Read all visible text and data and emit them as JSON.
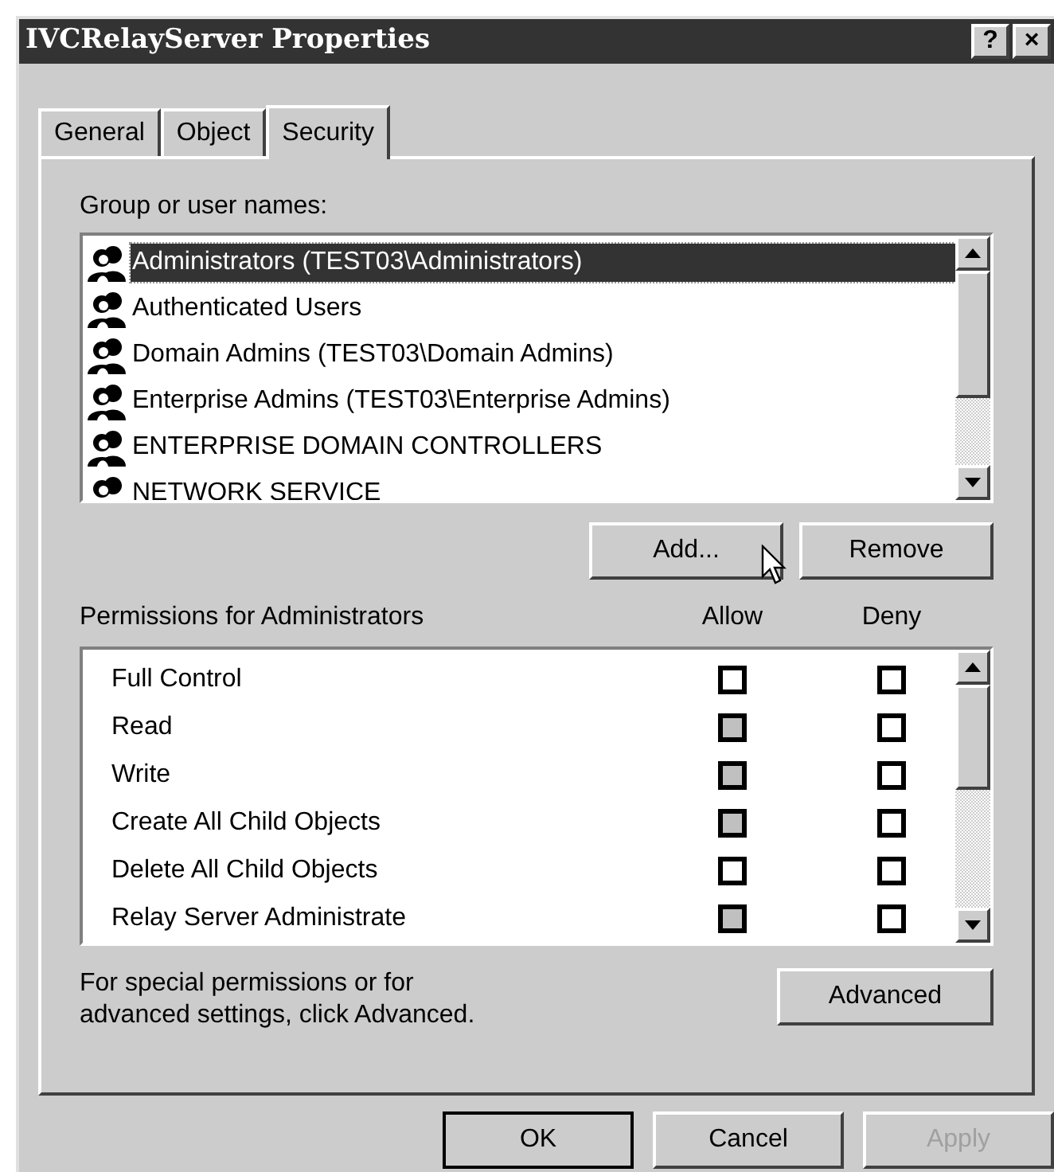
{
  "window": {
    "title": "IVCRelayServer Properties",
    "title_buttons": [
      "?",
      "×"
    ]
  },
  "tabs": [
    {
      "label": "General",
      "selected": false
    },
    {
      "label": "Object",
      "selected": false
    },
    {
      "label": "Security",
      "selected": true
    }
  ],
  "group_list": {
    "label": "Group or user names:",
    "items": [
      {
        "name": "Administrators (TEST03\\Administrators)",
        "selected": true
      },
      {
        "name": "Authenticated Users",
        "selected": false
      },
      {
        "name": "Domain Admins (TEST03\\Domain Admins)",
        "selected": false
      },
      {
        "name": "Enterprise Admins (TEST03\\Enterprise Admins)",
        "selected": false
      },
      {
        "name": "ENTERPRISE DOMAIN CONTROLLERS",
        "selected": false
      },
      {
        "name": "NETWORK SERVICE",
        "selected": false
      }
    ]
  },
  "group_buttons": [
    {
      "label": "Add..."
    },
    {
      "label": "Remove"
    }
  ],
  "permissions": {
    "label": "Permissions for Administrators",
    "allow_header": "Allow",
    "deny_header": "Deny",
    "rows": [
      {
        "name": "Full Control",
        "allow_greyed": false,
        "deny_greyed": false
      },
      {
        "name": "Read",
        "allow_greyed": true,
        "deny_greyed": false
      },
      {
        "name": "Write",
        "allow_greyed": true,
        "deny_greyed": false
      },
      {
        "name": "Create All Child Objects",
        "allow_greyed": true,
        "deny_greyed": false
      },
      {
        "name": "Delete All Child Objects",
        "allow_greyed": false,
        "deny_greyed": false
      },
      {
        "name": "Relay Server Administrate",
        "allow_greyed": true,
        "deny_greyed": false
      }
    ]
  },
  "advanced": {
    "note": "For special permissions or for advanced settings, click Advanced.",
    "button": {
      "label": "Advanced"
    }
  },
  "footer_buttons": [
    {
      "label": "OK",
      "default": true,
      "disabled": false
    },
    {
      "label": "Cancel",
      "default": false,
      "disabled": false
    },
    {
      "label": "Apply",
      "default": false,
      "disabled": true
    }
  ]
}
